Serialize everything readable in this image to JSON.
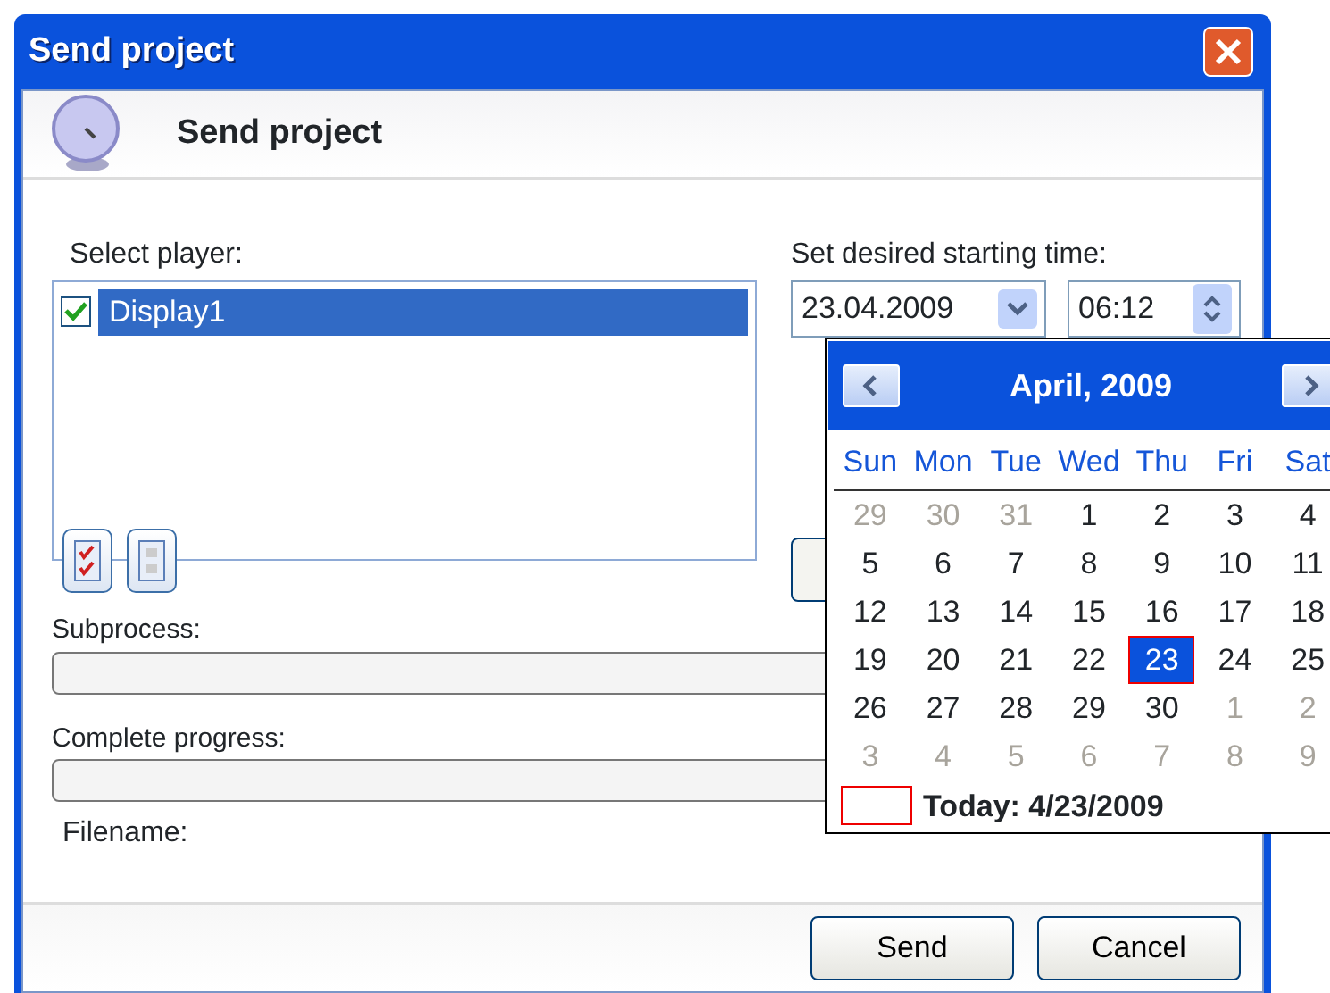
{
  "window": {
    "title": "Send project"
  },
  "header": {
    "title": "Send project"
  },
  "player_section": {
    "label": "Select player:",
    "players": [
      {
        "name": "Display1",
        "checked": true,
        "selected": true
      }
    ]
  },
  "time_section": {
    "label": "Set desired starting time:",
    "date": "23.04.2009",
    "time": "06:12"
  },
  "calendar": {
    "month": "April, 2009",
    "weekdays": [
      "Sun",
      "Mon",
      "Tue",
      "Wed",
      "Thu",
      "Fri",
      "Sat"
    ],
    "weeks": [
      [
        {
          "day": "29",
          "muted": true,
          "selected": false
        },
        {
          "day": "30",
          "muted": true,
          "selected": false
        },
        {
          "day": "31",
          "muted": true,
          "selected": false
        },
        {
          "day": "1",
          "muted": false,
          "selected": false
        },
        {
          "day": "2",
          "muted": false,
          "selected": false
        },
        {
          "day": "3",
          "muted": false,
          "selected": false
        },
        {
          "day": "4",
          "muted": false,
          "selected": false
        }
      ],
      [
        {
          "day": "5",
          "muted": false,
          "selected": false
        },
        {
          "day": "6",
          "muted": false,
          "selected": false
        },
        {
          "day": "7",
          "muted": false,
          "selected": false
        },
        {
          "day": "8",
          "muted": false,
          "selected": false
        },
        {
          "day": "9",
          "muted": false,
          "selected": false
        },
        {
          "day": "10",
          "muted": false,
          "selected": false
        },
        {
          "day": "11",
          "muted": false,
          "selected": false
        }
      ],
      [
        {
          "day": "12",
          "muted": false,
          "selected": false
        },
        {
          "day": "13",
          "muted": false,
          "selected": false
        },
        {
          "day": "14",
          "muted": false,
          "selected": false
        },
        {
          "day": "15",
          "muted": false,
          "selected": false
        },
        {
          "day": "16",
          "muted": false,
          "selected": false
        },
        {
          "day": "17",
          "muted": false,
          "selected": false
        },
        {
          "day": "18",
          "muted": false,
          "selected": false
        }
      ],
      [
        {
          "day": "19",
          "muted": false,
          "selected": false
        },
        {
          "day": "20",
          "muted": false,
          "selected": false
        },
        {
          "day": "21",
          "muted": false,
          "selected": false
        },
        {
          "day": "22",
          "muted": false,
          "selected": false
        },
        {
          "day": "23",
          "muted": false,
          "selected": true
        },
        {
          "day": "24",
          "muted": false,
          "selected": false
        },
        {
          "day": "25",
          "muted": false,
          "selected": false
        }
      ],
      [
        {
          "day": "26",
          "muted": false,
          "selected": false
        },
        {
          "day": "27",
          "muted": false,
          "selected": false
        },
        {
          "day": "28",
          "muted": false,
          "selected": false
        },
        {
          "day": "29",
          "muted": false,
          "selected": false
        },
        {
          "day": "30",
          "muted": false,
          "selected": false
        },
        {
          "day": "1",
          "muted": true,
          "selected": false
        },
        {
          "day": "2",
          "muted": true,
          "selected": false
        }
      ],
      [
        {
          "day": "3",
          "muted": true,
          "selected": false
        },
        {
          "day": "4",
          "muted": true,
          "selected": false
        },
        {
          "day": "5",
          "muted": true,
          "selected": false
        },
        {
          "day": "6",
          "muted": true,
          "selected": false
        },
        {
          "day": "7",
          "muted": true,
          "selected": false
        },
        {
          "day": "8",
          "muted": true,
          "selected": false
        },
        {
          "day": "9",
          "muted": true,
          "selected": false
        }
      ]
    ],
    "today": "Today: 4/23/2009"
  },
  "progress": [
    {
      "label": "Subprocess:",
      "level": 0
    },
    {
      "label": "Complete progress:",
      "level": 0
    }
  ],
  "filename": {
    "label": "Filename:"
  },
  "buttons": [
    "Send",
    "Cancel"
  ]
}
